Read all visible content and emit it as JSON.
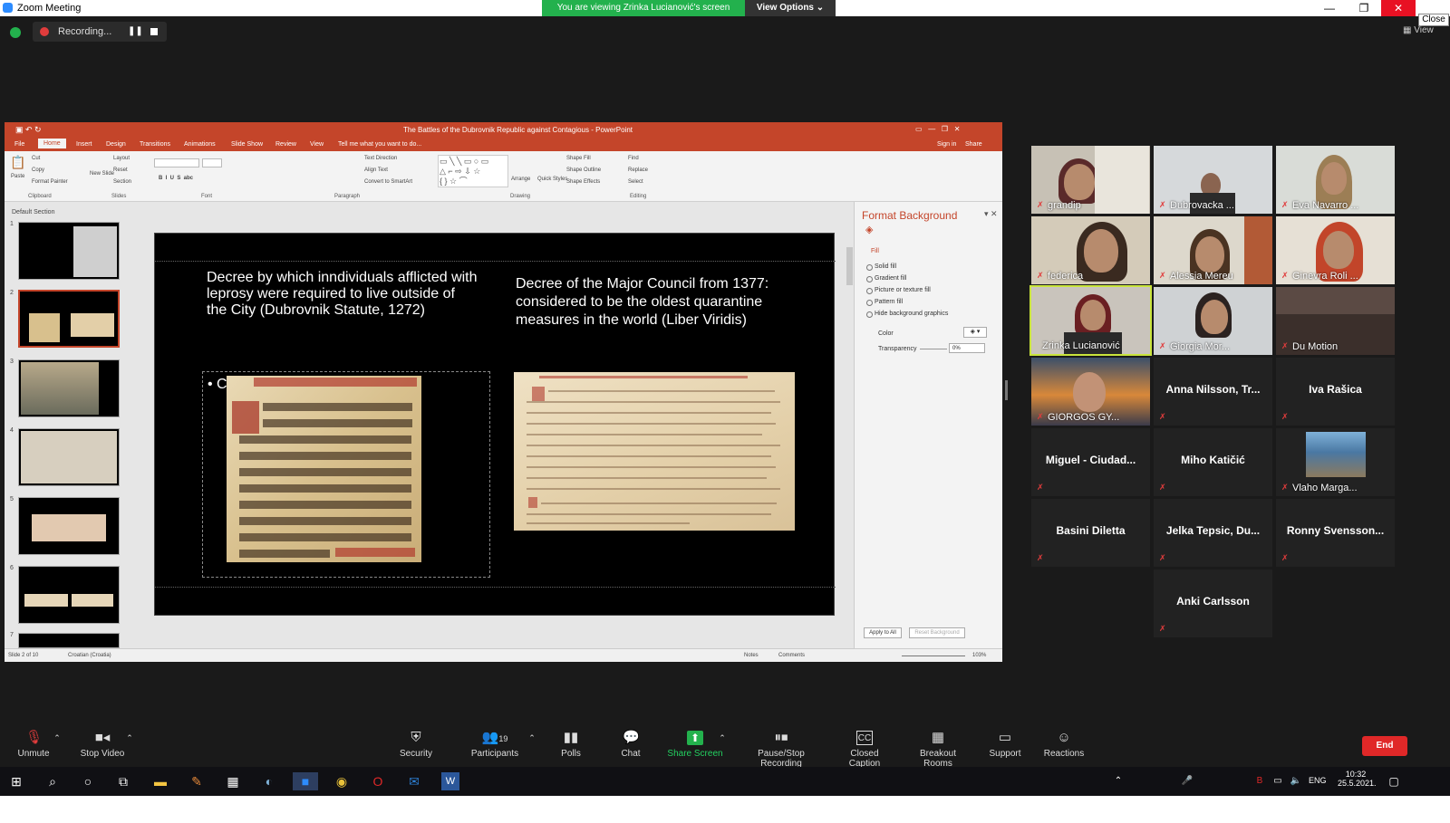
{
  "window": {
    "title": "Zoom Meeting",
    "viewing_banner": "You are viewing Zrinka Lucianović's screen",
    "view_options": "View Options ⌄",
    "close_tooltip": "Close",
    "view_label": "View"
  },
  "recording": {
    "label": "Recording...",
    "pause": "❚❚"
  },
  "ppt": {
    "title": "The Battles of the Dubrovnik Republic against Contagious - PowerPoint",
    "tabs": [
      "File",
      "Home",
      "Insert",
      "Design",
      "Transitions",
      "Animations",
      "Slide Show",
      "Review",
      "View",
      "Tell me what you want to do..."
    ],
    "sign_in": "Sign in",
    "share": "Share",
    "ribbon": {
      "paste": "Paste",
      "cut": "Cut",
      "copy": "Copy",
      "format_painter": "Format Painter",
      "clipboard": "Clipboard",
      "layout": "Layout",
      "reset": "Reset",
      "new_slide": "New Slide",
      "section": "Section",
      "slides": "Slides",
      "font": "Font",
      "text_direction": "Text Direction",
      "align_text": "Align Text",
      "convert_smartart": "Convert to SmartArt",
      "paragraph": "Paragraph",
      "arrange": "Arrange",
      "quick_styles": "Quick Styles",
      "shape_fill": "Shape Fill",
      "shape_outline": "Shape Outline",
      "shape_effects": "Shape Effects",
      "drawing": "Drawing",
      "find": "Find",
      "replace": "Replace",
      "select": "Select",
      "editing": "Editing"
    },
    "section_label": "Default Section",
    "slide_numbers": [
      "1",
      "2",
      "3",
      "4",
      "5",
      "6",
      "7"
    ],
    "slide": {
      "left_title": "Decree by which inndividuals afflicted with leprosy were required to live outside of the City (Dubrovnik Statute, 1272)",
      "right_title": "Decree of the Major Council from 1377: considered to be the oldest quarantine measures in the world (Liber Viridis)",
      "bullet": "• C"
    },
    "format_background": {
      "title": "Format Background",
      "fill_header": "Fill",
      "options": [
        "Solid fill",
        "Gradient fill",
        "Picture or texture fill",
        "Pattern fill",
        "Hide background graphics"
      ],
      "color_label": "Color",
      "transparency_label": "Transparency",
      "transparency_value": "0%",
      "apply_all": "Apply to All",
      "reset_bg": "Reset Background"
    },
    "status": {
      "slide": "Slide 2 of 10",
      "language": "Croatian (Croatia)",
      "notes": "Notes",
      "comments": "Comments",
      "zoom": "103%"
    }
  },
  "participants": [
    {
      "name": "grandip"
    },
    {
      "name": "Dubrovacka ..."
    },
    {
      "name": "Eva Navarro ..."
    },
    {
      "name": "federica"
    },
    {
      "name": "Alessia Mereu"
    },
    {
      "name": "Ginevra Roli ..."
    },
    {
      "name": "Zrinka Lucianović"
    },
    {
      "name": "Giorgia Mor..."
    },
    {
      "name": "Du Motion"
    },
    {
      "name": "GIORGOS GY..."
    },
    {
      "name": "Anna Nilsson, Tr..."
    },
    {
      "name": "Iva Rašica"
    },
    {
      "name": "Miguel - Ciudad..."
    },
    {
      "name": "Miho Katičić"
    },
    {
      "name": "Vlaho Marga..."
    },
    {
      "name": "Basini Diletta"
    },
    {
      "name": "Jelka Tepsic, Du..."
    },
    {
      "name": "Ronny Svensson..."
    },
    {
      "name": "Anki Carlsson"
    }
  ],
  "toolbar": {
    "unmute": "Unmute",
    "stop_video": "Stop Video",
    "security": "Security",
    "participants": "Participants",
    "participants_count": "19",
    "polls": "Polls",
    "chat": "Chat",
    "share_screen": "Share Screen",
    "pause_stop_recording": "Pause/Stop Recording",
    "closed_caption": "Closed Caption",
    "breakout_rooms": "Breakout Rooms",
    "support": "Support",
    "reactions": "Reactions",
    "end": "End"
  },
  "taskbar": {
    "lang": "ENG",
    "time": "10:32",
    "date": "25.5.2021."
  }
}
